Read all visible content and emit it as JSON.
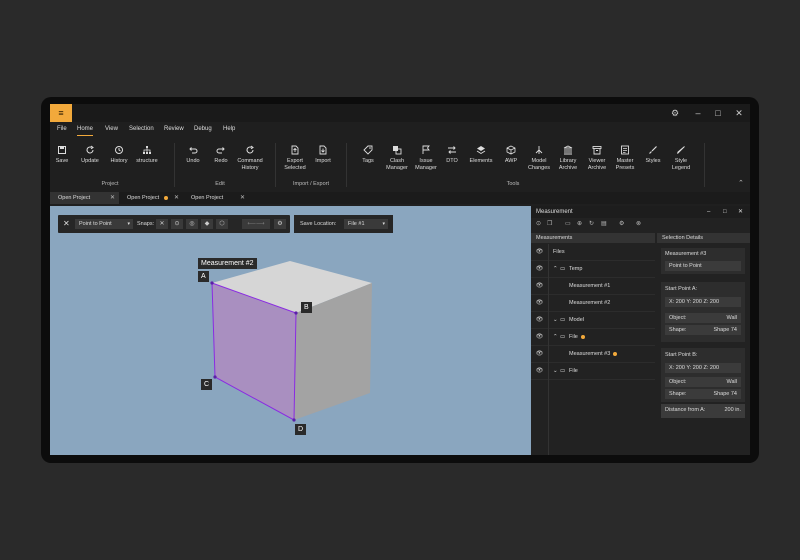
{
  "app": {
    "menu_icon": "hamburger-icon",
    "menus": [
      "File",
      "Home",
      "View",
      "Selection",
      "Review",
      "Debug",
      "Help"
    ],
    "active_menu": "Home"
  },
  "ribbon": {
    "project": {
      "label": "Project",
      "save": "Save",
      "update": "Update",
      "history": "History",
      "structure": "structure"
    },
    "edit": {
      "label": "Edit",
      "undo": "Undo",
      "redo": "Redo",
      "command_history_1": "Command",
      "command_history_2": "History"
    },
    "import_export": {
      "label": "Import / Export",
      "export_1": "Export",
      "export_2": "Selected",
      "import": "Import"
    },
    "tools": {
      "label": "Tools",
      "tags": "Tags",
      "clash_1": "Clash",
      "clash_2": "Manager",
      "issue_1": "Issue",
      "issue_2": "Manager",
      "dto": "DTO",
      "elements": "Elements",
      "awp": "AWP",
      "model_1": "Model",
      "model_2": "Changes",
      "library_1": "Library",
      "library_2": "Archive",
      "viewer_1": "Viewer",
      "viewer_2": "Archive",
      "master_1": "Master",
      "master_2": "Presets",
      "styles": "Styles",
      "style_legend_1": "Style",
      "style_legend_2": "Legend"
    }
  },
  "doc_tabs": [
    {
      "label": "Open Project",
      "active": true
    },
    {
      "label": "Open Project",
      "active": false,
      "modified": true
    },
    {
      "label": "Open Project",
      "active": false
    }
  ],
  "viewport": {
    "mode_select": "Point to Point",
    "snaps_label": "Snaps:",
    "save_location_label": "Save Location:",
    "save_location_value": "File #1",
    "measurement_title": "Measurement #2",
    "points": [
      "A",
      "B",
      "C",
      "D"
    ],
    "colors": {
      "background": "#8aa6bf",
      "face_highlight": "#a98fc0",
      "edge": "#8a2be2"
    }
  },
  "panel": {
    "title": "Measurement",
    "measurements_header": "Measurements",
    "details_header": "Selection Details",
    "tree": [
      {
        "label": "Files",
        "indent": 0,
        "expander": ""
      },
      {
        "label": "Temp",
        "indent": 1,
        "expander": "^",
        "folder": true
      },
      {
        "label": "Measurement #1",
        "indent": 2,
        "expander": ""
      },
      {
        "label": "Measurement #2",
        "indent": 2,
        "expander": ""
      },
      {
        "label": "Model",
        "indent": 1,
        "expander": "v",
        "folder": true
      },
      {
        "label": "File",
        "indent": 1,
        "expander": "^",
        "folder": true,
        "modified": true
      },
      {
        "label": "Measurement #3",
        "indent": 2,
        "expander": "",
        "modified": true
      },
      {
        "label": "File",
        "indent": 1,
        "expander": "v",
        "folder": true
      }
    ],
    "details": {
      "name": "Measurement #3",
      "type": "Point to Point",
      "start_a_label": "Start Point A:",
      "start_a_coords": "X: 200   Y: 200   Z: 200",
      "object_label": "Object:",
      "object_value": "Wall",
      "shape_label": "Shape:",
      "shape_value": "Shape 74",
      "start_b_label": "Start Point B:",
      "start_b_coords": "X: 200   Y: 200   Z: 200",
      "object_b_value": "Wall",
      "shape_b_value": "Shape 74",
      "distance_label": "Distance from A:",
      "distance_value": "200 in."
    }
  }
}
